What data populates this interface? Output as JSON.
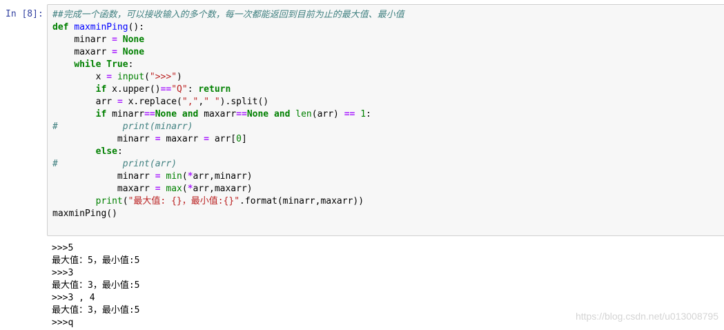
{
  "cell": {
    "prompt": "In [8]:",
    "code": {
      "l0": "##完成一个函数，可以接收输入的多个数，每一次都能返回到目前为止的最大值、最小值",
      "l1_def": "def",
      "l1_name": "maxminPing",
      "l1_rest": "():",
      "l2_var": "minarr",
      "l2_eq": "=",
      "l2_val": "None",
      "l3_var": "maxarr",
      "l3_eq": "=",
      "l3_val": "None",
      "l4_while": "while",
      "l4_true": "True",
      "l4_colon": ":",
      "l5_x": "x",
      "l5_eq": "=",
      "l5_input": "input",
      "l5_open": "(",
      "l5_str": "\">>>\"",
      "l5_close": ")",
      "l6_if": "if",
      "l6_mid": "x.upper()",
      "l6_op": "==",
      "l6_str": "\"Q\"",
      "l6_colon": ":",
      "l6_return": "return",
      "l7_arr": "arr",
      "l7_eq": "=",
      "l7_a": "x.replace(",
      "l7_s1": "\",\"",
      "l7_comma": ",",
      "l7_s2": "\" \"",
      "l7_b": ").split()",
      "l8_if": "if",
      "l8_a": "minarr",
      "l8_op1": "==",
      "l8_none1": "None",
      "l8_and1": "and",
      "l8_b": "maxarr",
      "l8_op2": "==",
      "l8_none2": "None",
      "l8_and2": "and",
      "l8_len": "len",
      "l8_c": "(arr)",
      "l8_op3": "==",
      "l8_one": "1",
      "l8_colon": ":",
      "l9_hash": "#",
      "l9_text": "print(minarr)",
      "l10_a": "minarr",
      "l10_eq1": "=",
      "l10_b": "maxarr",
      "l10_eq2": "=",
      "l10_c": "arr[",
      "l10_zero": "0",
      "l10_d": "]",
      "l11_else": "else",
      "l11_colon": ":",
      "l12_hash": "#",
      "l12_text": "print(arr)",
      "l13_a": "minarr",
      "l13_eq": "=",
      "l13_min": "min",
      "l13_open": "(",
      "l13_star": "*",
      "l13_rest": "arr,minarr)",
      "l14_a": "maxarr",
      "l14_eq": "=",
      "l14_max": "max",
      "l14_open": "(",
      "l14_star": "*",
      "l14_rest": "arr,maxarr)",
      "l15_print": "print",
      "l15_open": "(",
      "l15_str": "\"最大值: {}，最小值:{}\"",
      "l15_rest": ".format(minarr,maxarr))",
      "l16": "maxminPing()"
    }
  },
  "output": [
    ">>>5",
    "最大值：5，最小值:5",
    ">>>3",
    "最大值：3，最小值:5",
    ">>>3 , 4",
    "最大值：3，最小值:5",
    ">>>q"
  ],
  "watermark": "https://blog.csdn.net/u013008795"
}
